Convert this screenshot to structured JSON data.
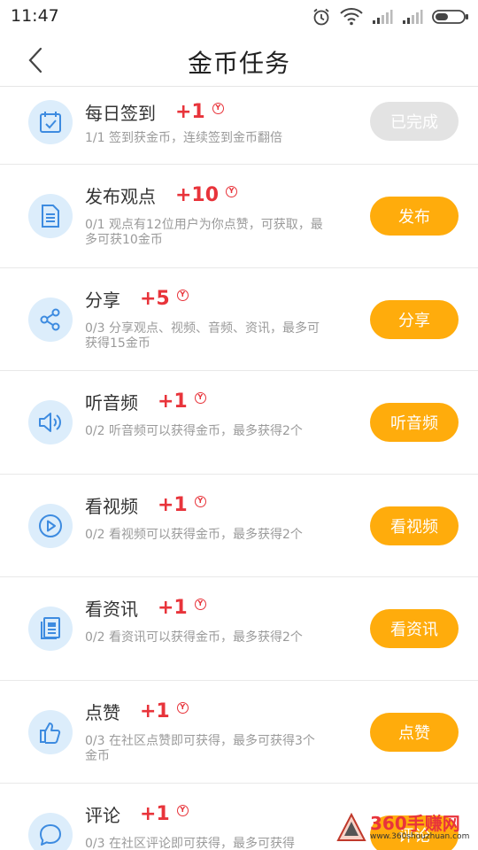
{
  "status_bar": {
    "time": "11:47"
  },
  "header": {
    "title": "金币任务"
  },
  "tasks": [
    {
      "name": "每日签到",
      "reward": "+1",
      "coin": "Y",
      "desc": "1/1 签到获金币，连续签到金币翻倍",
      "button": "已完成",
      "state": "done",
      "icon": "calendar-check-icon"
    },
    {
      "name": "发布观点",
      "reward": "+10",
      "coin": "Y",
      "desc": "0/1 观点有12位用户为你点赞，可获取，最多可获10金币",
      "button": "发布",
      "state": "active",
      "icon": "document-icon"
    },
    {
      "name": "分享",
      "reward": "+5",
      "coin": "Y",
      "desc": "0/3 分享观点、视频、音频、资讯，最多可获得15金币",
      "button": "分享",
      "state": "active",
      "icon": "share-icon"
    },
    {
      "name": "听音频",
      "reward": "+1",
      "coin": "Y",
      "desc": "0/2  听音频可以获得金币，最多获得2个",
      "button": "听音频",
      "state": "active",
      "icon": "speaker-icon"
    },
    {
      "name": "看视频",
      "reward": "+1",
      "coin": "Y",
      "desc": "0/2 看视频可以获得金币，最多获得2个",
      "button": "看视频",
      "state": "active",
      "icon": "play-icon"
    },
    {
      "name": "看资讯",
      "reward": "+1",
      "coin": "Y",
      "desc": "0/2 看资讯可以获得金币，最多获得2个",
      "button": "看资讯",
      "state": "active",
      "icon": "news-icon"
    },
    {
      "name": "点赞",
      "reward": "+1",
      "coin": "Y",
      "desc": "0/3 在社区点赞即可获得，最多可获得3个金币",
      "button": "点赞",
      "state": "active",
      "icon": "thumbs-up-icon"
    },
    {
      "name": "评论",
      "reward": "+1",
      "coin": "Y",
      "desc": "0/3 在社区评论即可获得，最多可获得",
      "button": "评论",
      "state": "active",
      "icon": "comment-icon"
    }
  ],
  "watermark": {
    "title": "360手赚网",
    "url": "www.360shouzhuan.com"
  },
  "colors": {
    "accent": "#ffac0c",
    "reward": "#e8343b",
    "icon_bg": "#dcedfb",
    "icon_stroke": "#3d8be0",
    "done": "#e3e3e3"
  }
}
